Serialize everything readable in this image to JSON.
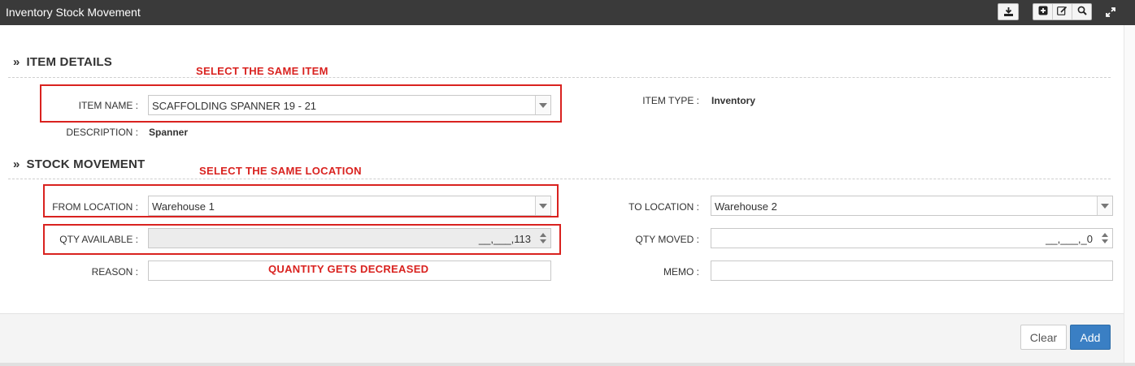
{
  "window": {
    "title": "Inventory Stock Movement"
  },
  "toolbar": {
    "download_icon": "download-icon",
    "add_icon": "plus-square-icon",
    "edit_icon": "edit-icon",
    "search_icon": "search-icon",
    "expand_icon": "expand-icon"
  },
  "item_details": {
    "heading": "ITEM DETAILS",
    "item_name_label": "ITEM NAME :",
    "item_name_value": "SCAFFOLDING SPANNER 19 - 21",
    "item_type_label": "ITEM TYPE :",
    "item_type_value": "Inventory",
    "description_label": "DESCRIPTION :",
    "description_value": "Spanner"
  },
  "stock_movement": {
    "heading": "STOCK MOVEMENT",
    "from_location_label": "FROM LOCATION :",
    "from_location_value": "Warehouse 1",
    "to_location_label": "TO LOCATION :",
    "to_location_value": "Warehouse 2",
    "qty_available_label": "QTY AVAILABLE :",
    "qty_available_value": "__,___,113",
    "qty_moved_label": "QTY MOVED :",
    "qty_moved_value": "__,___,_0",
    "reason_label": "REASON :",
    "memo_label": "MEMO :"
  },
  "annotations": {
    "item": "SELECT THE SAME ITEM",
    "location": "SELECT THE SAME LOCATION",
    "quantity": "QUANTITY GETS DECREASED",
    "color": "#d9221f"
  },
  "footer": {
    "clear_label": "Clear",
    "add_label": "Add",
    "add_color": "#3a7fc4"
  }
}
